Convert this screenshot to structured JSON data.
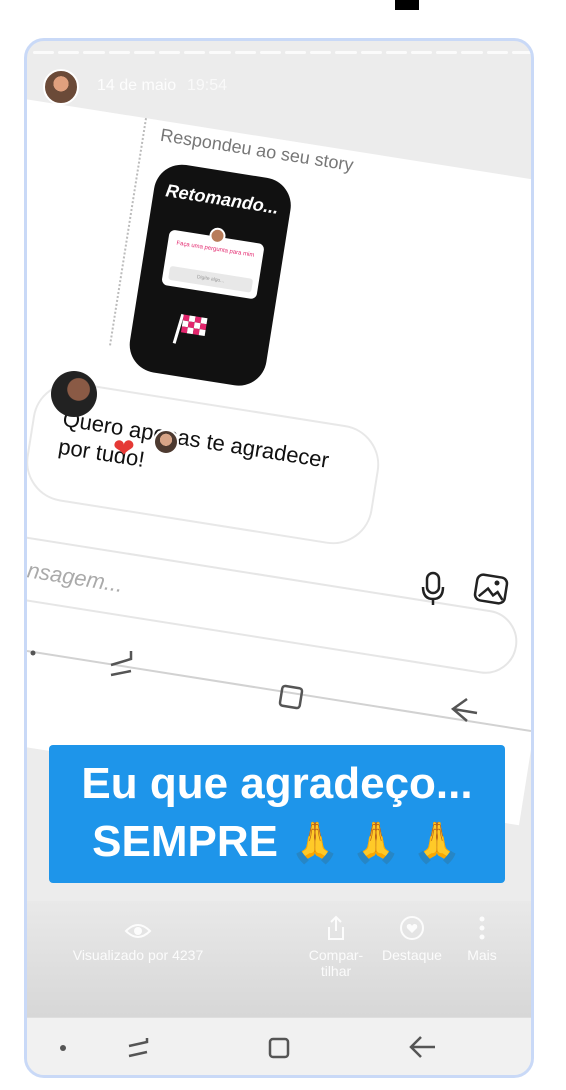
{
  "story": {
    "date": "14 de maio",
    "time": "19:54"
  },
  "dm": {
    "replied_label": "Respondeu ao seu story",
    "thumb_title": "Retomando...",
    "thumb_card_text": "Faça uma pergunta para mim",
    "thumb_card_input": "Digite algo...",
    "message": "Quero apenas te agradecer por tudo!",
    "input_placeholder": "Mensagem..."
  },
  "banner": {
    "line1": "Eu que agradeço...",
    "line2": "SEMPRE",
    "emoji": "🙏 🙏 🙏"
  },
  "actions": {
    "viewed": "Visualizado por 4237",
    "share": "Compar-tilhar",
    "highlight": "Destaque",
    "more": "Mais"
  },
  "colors": {
    "accent": "#1e95ea",
    "heart": "#e53935",
    "camera": "#3797f0"
  }
}
